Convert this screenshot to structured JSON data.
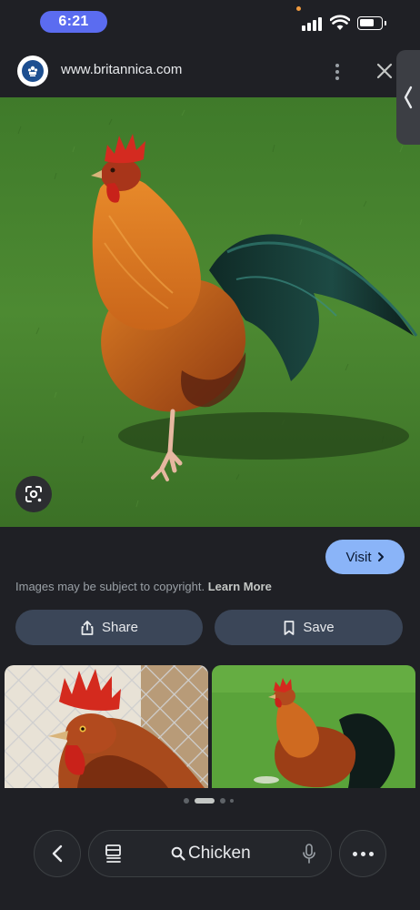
{
  "status_bar": {
    "time": "6:21",
    "icons": [
      "signal-icon",
      "wifi-icon",
      "battery-icon"
    ]
  },
  "browser": {
    "url": "www.britannica.com",
    "site_icon": "britannica-logo-icon"
  },
  "viewer": {
    "visit_label": "Visit",
    "copyright_text": "Images may be subject to copyright.",
    "learn_more": "Learn More",
    "share_label": "Share",
    "save_label": "Save",
    "accent_color": "#8ab4f8",
    "button_bg": "#3b4658"
  },
  "pager": {
    "count": 4,
    "active_index": 1
  },
  "bottom_bar": {
    "search_query": "Chicken"
  }
}
